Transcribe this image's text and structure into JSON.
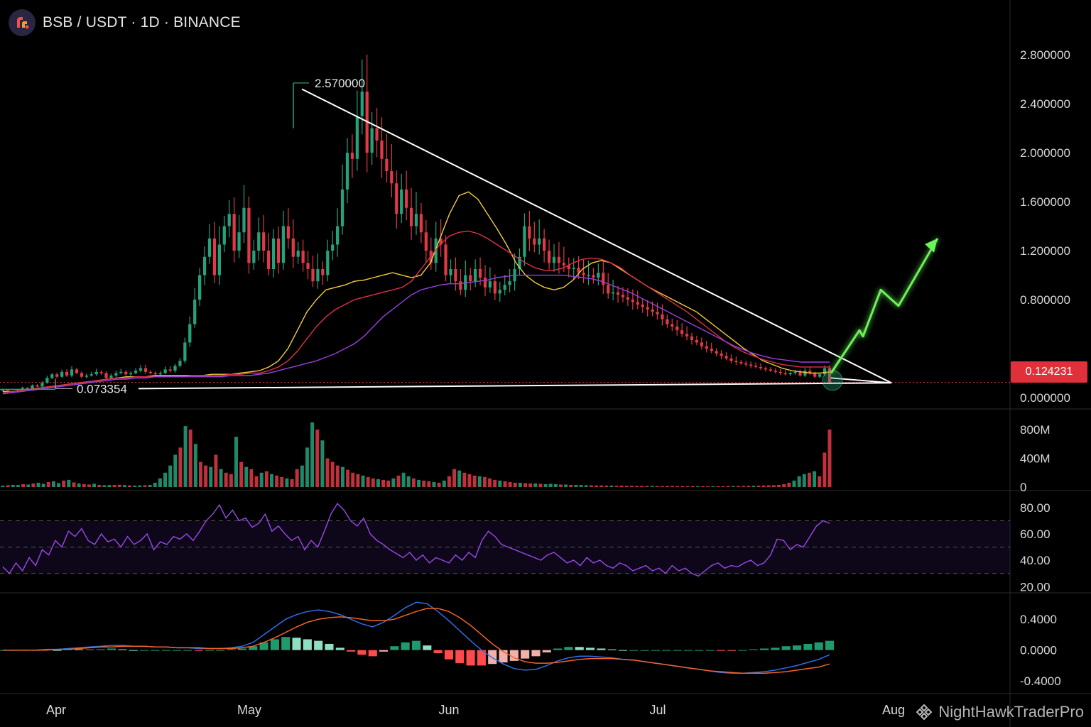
{
  "header": {
    "title": "BSB / USDT · 1D · BINANCE",
    "logo_icon": "exchange-logo-icon"
  },
  "watermark": {
    "text": "NightHawkTraderPro",
    "icon": "binance-diamond-icon"
  },
  "last_price": "0.124231",
  "colors": {
    "up": "#26a17b",
    "down": "#e03a45",
    "ema_fast": "#f2cc3a",
    "ema_mid": "#e0304a",
    "ema_slow": "#9a3fe0",
    "trendline": "#ffffff",
    "projection": "#6cf25a",
    "rsi_line": "#9b48e8",
    "macd_line": "#2f6fe8",
    "signal_line": "#f0642a",
    "price_badge": "#e0303a"
  },
  "chart_data": [
    {
      "type": "candlestick",
      "panel": "price",
      "title": "BSB / USDT · 1D · BINANCE",
      "x_tick_labels": [
        "Apr",
        "May",
        "Jun",
        "Jul",
        "Aug"
      ],
      "y_tick_labels": [
        "2.800000",
        "2.400000",
        "2.000000",
        "1.600000",
        "1.200000",
        "0.800000",
        "0.000000"
      ],
      "ylim": [
        0,
        2.9
      ],
      "annotations": [
        {
          "label": "2.570000",
          "type": "high"
        },
        {
          "label": "0.073354",
          "type": "low"
        }
      ],
      "current_price": 0.124231,
      "trendlines": [
        {
          "name": "upper",
          "from": [
            0.425,
            2.52
          ],
          "to": [
            1.255,
            0.12
          ]
        },
        {
          "name": "lower",
          "from": [
            0.195,
            0.073354
          ],
          "to": [
            1.255,
            0.12
          ]
        }
      ],
      "projection_path": [
        [
          1.17,
          0.2
        ],
        [
          1.21,
          0.55
        ],
        [
          1.215,
          0.5
        ],
        [
          1.24,
          0.88
        ],
        [
          1.265,
          0.75
        ],
        [
          1.32,
          1.3
        ]
      ],
      "closes": [
        0.06,
        0.05,
        0.05,
        0.06,
        0.08,
        0.07,
        0.1,
        0.09,
        0.12,
        0.16,
        0.19,
        0.17,
        0.21,
        0.18,
        0.23,
        0.2,
        0.17,
        0.18,
        0.19,
        0.21,
        0.2,
        0.16,
        0.18,
        0.2,
        0.21,
        0.19,
        0.2,
        0.22,
        0.24,
        0.21,
        0.2,
        0.19,
        0.2,
        0.23,
        0.22,
        0.26,
        0.3,
        0.45,
        0.6,
        0.8,
        1.0,
        1.15,
        1.3,
        1.0,
        1.25,
        1.4,
        1.5,
        1.2,
        1.35,
        1.55,
        1.1,
        1.2,
        1.35,
        1.2,
        1.05,
        1.3,
        1.1,
        1.4,
        1.3,
        1.15,
        1.2,
        1.1,
        1.05,
        0.95,
        1.05,
        1.0,
        1.2,
        1.25,
        1.4,
        1.7,
        2.0,
        1.95,
        2.3,
        2.5,
        2.0,
        2.2,
        2.1,
        1.95,
        1.85,
        1.75,
        1.5,
        1.7,
        1.55,
        1.4,
        1.5,
        1.35,
        1.2,
        1.1,
        1.3,
        1.25,
        1.0,
        1.05,
        0.95,
        0.88,
        1.0,
        0.95,
        1.05,
        0.98,
        0.9,
        0.95,
        0.85,
        0.88,
        0.92,
        0.95,
        1.05,
        1.15,
        1.4,
        1.3,
        1.25,
        1.3,
        1.2,
        1.1,
        1.15,
        1.1,
        1.08,
        1.05,
        1.06,
        1.02,
        1.0,
        1.0,
        0.98,
        1.02,
        0.92,
        0.85,
        0.86,
        0.84,
        0.82,
        0.8,
        0.78,
        0.76,
        0.74,
        0.72,
        0.7,
        0.68,
        0.64,
        0.6,
        0.58,
        0.55,
        0.52,
        0.5,
        0.47,
        0.45,
        0.42,
        0.4,
        0.38,
        0.36,
        0.34,
        0.32,
        0.3,
        0.29,
        0.28,
        0.27,
        0.26,
        0.25,
        0.24,
        0.23,
        0.22,
        0.21,
        0.2,
        0.19,
        0.2,
        0.21,
        0.18,
        0.22,
        0.2,
        0.17,
        0.19,
        0.24,
        0.124231
      ],
      "moving_averages": [
        {
          "name": "",
          "values": [
            0.05,
            0.05,
            0.06,
            0.07,
            0.08,
            0.09,
            0.1,
            0.11,
            0.12,
            0.13,
            0.14,
            0.15,
            0.16,
            0.17,
            0.17,
            0.17,
            0.18,
            0.18,
            0.18,
            0.18,
            0.18,
            0.18,
            0.19,
            0.19,
            0.19,
            0.2,
            0.21,
            0.22,
            0.25,
            0.3,
            0.4,
            0.55,
            0.7,
            0.8,
            0.88,
            0.9,
            0.92,
            0.95,
            0.96,
            0.98,
            1.0,
            1.02,
            1.0,
            0.98,
            1.0,
            1.1,
            1.3,
            1.5,
            1.65,
            1.68,
            1.62,
            1.5,
            1.38,
            1.25,
            1.1,
            1.0,
            0.94,
            0.9,
            0.88,
            0.9,
            0.96,
            1.05,
            1.1,
            1.12,
            1.1,
            1.05,
            1.0,
            0.95,
            0.9,
            0.86,
            0.82,
            0.78,
            0.74,
            0.7,
            0.64,
            0.58,
            0.52,
            0.46,
            0.4,
            0.35,
            0.3,
            0.27,
            0.24,
            0.22,
            0.21,
            0.2,
            0.2,
            0.21
          ]
        },
        {
          "name": "",
          "values": [
            0.04,
            0.05,
            0.06,
            0.07,
            0.08,
            0.09,
            0.1,
            0.11,
            0.12,
            0.13,
            0.14,
            0.15,
            0.16,
            0.16,
            0.17,
            0.17,
            0.17,
            0.17,
            0.17,
            0.17,
            0.18,
            0.18,
            0.18,
            0.18,
            0.19,
            0.19,
            0.2,
            0.2,
            0.22,
            0.25,
            0.3,
            0.38,
            0.48,
            0.58,
            0.66,
            0.72,
            0.76,
            0.8,
            0.82,
            0.84,
            0.86,
            0.88,
            0.9,
            0.95,
            1.05,
            1.15,
            1.25,
            1.32,
            1.35,
            1.36,
            1.34,
            1.3,
            1.25,
            1.2,
            1.15,
            1.1,
            1.06,
            1.04,
            1.04,
            1.06,
            1.1,
            1.13,
            1.14,
            1.13,
            1.1,
            1.06,
            1.0,
            0.95,
            0.9,
            0.85,
            0.8,
            0.75,
            0.7,
            0.64,
            0.58,
            0.52,
            0.46,
            0.41,
            0.37,
            0.34,
            0.31,
            0.29,
            0.27,
            0.26,
            0.25,
            0.25,
            0.25,
            0.25
          ]
        },
        {
          "name": "",
          "values": [
            0.03,
            0.04,
            0.05,
            0.06,
            0.07,
            0.08,
            0.09,
            0.1,
            0.11,
            0.12,
            0.13,
            0.14,
            0.15,
            0.15,
            0.16,
            0.16,
            0.17,
            0.17,
            0.17,
            0.17,
            0.17,
            0.17,
            0.17,
            0.17,
            0.18,
            0.18,
            0.18,
            0.19,
            0.2,
            0.22,
            0.24,
            0.26,
            0.28,
            0.3,
            0.33,
            0.36,
            0.4,
            0.44,
            0.5,
            0.58,
            0.66,
            0.72,
            0.78,
            0.84,
            0.88,
            0.9,
            0.92,
            0.93,
            0.93,
            0.94,
            0.95,
            0.96,
            0.98,
            0.99,
            1.0,
            1.0,
            1.0,
            1.0,
            1.0,
            1.0,
            0.99,
            0.98,
            0.97,
            0.95,
            0.92,
            0.89,
            0.86,
            0.82,
            0.78,
            0.74,
            0.7,
            0.66,
            0.62,
            0.58,
            0.54,
            0.5,
            0.46,
            0.42,
            0.39,
            0.36,
            0.34,
            0.32,
            0.31,
            0.3,
            0.29,
            0.29,
            0.29,
            0.29
          ]
        }
      ]
    },
    {
      "type": "bar",
      "panel": "volume",
      "y_tick_labels": [
        "800M",
        "400M",
        "0"
      ],
      "ylim": [
        0,
        900
      ],
      "values_millions": [
        20,
        25,
        30,
        28,
        40,
        35,
        50,
        60,
        45,
        70,
        80,
        55,
        90,
        100,
        65,
        50,
        40,
        35,
        45,
        30,
        25,
        28,
        30,
        32,
        28,
        24,
        20,
        22,
        25,
        30,
        60,
        120,
        200,
        300,
        450,
        550,
        850,
        800,
        600,
        350,
        300,
        280,
        450,
        250,
        200,
        180,
        700,
        350,
        280,
        250,
        150,
        200,
        220,
        180,
        160,
        140,
        120,
        110,
        250,
        300,
        550,
        900,
        800,
        650,
        400,
        350,
        300,
        280,
        240,
        200,
        180,
        160,
        140,
        120,
        110,
        100,
        90,
        120,
        160,
        200,
        150,
        120,
        100,
        90,
        80,
        70,
        60,
        90,
        150,
        250,
        230,
        200,
        180,
        160,
        150,
        140,
        120,
        100,
        90,
        80,
        70,
        60,
        60,
        55,
        50,
        50,
        45,
        40,
        45,
        40,
        35,
        35,
        30,
        30,
        28,
        25,
        25,
        22,
        22,
        20,
        20,
        18,
        20,
        18,
        18,
        16,
        16,
        15,
        15,
        14,
        14,
        15,
        16,
        14,
        14,
        13,
        13,
        12,
        12,
        12,
        12,
        12,
        13,
        14,
        14,
        15,
        16,
        17,
        18,
        20,
        22,
        24,
        26,
        30,
        40,
        60,
        90,
        150,
        180,
        200,
        220,
        150,
        480,
        800
      ],
      "up_flags": [
        1,
        0,
        1,
        1,
        0,
        1,
        0,
        1,
        1,
        0,
        1,
        1,
        0,
        1,
        0,
        1,
        0,
        0,
        1,
        0,
        1,
        1,
        0,
        0,
        1,
        0,
        1,
        1,
        0,
        1,
        1,
        1,
        1,
        1,
        1,
        0,
        1,
        0,
        1,
        0,
        0,
        1,
        0,
        1,
        0,
        0,
        1,
        0,
        1,
        0,
        0,
        1,
        0,
        1,
        0,
        0,
        1,
        0,
        0,
        1,
        1,
        1,
        0,
        1,
        0,
        0,
        0,
        1,
        0,
        0,
        0,
        1,
        0,
        0,
        1,
        0,
        0,
        1,
        0,
        1,
        1,
        0,
        1,
        0,
        0,
        1,
        0,
        1,
        0,
        0,
        1,
        0,
        0,
        0,
        1,
        0,
        0,
        0,
        1,
        0,
        0,
        0,
        1,
        0,
        0,
        1,
        0,
        1,
        1,
        1,
        0,
        1,
        0,
        1,
        1,
        1,
        0,
        0,
        0,
        0,
        1,
        0,
        0,
        0,
        0,
        0,
        0,
        0,
        1,
        0,
        0,
        0,
        0,
        0,
        0,
        0,
        0,
        1,
        0,
        0,
        1,
        0,
        0,
        0,
        1,
        0,
        0,
        0,
        1,
        0,
        0,
        0,
        0,
        0,
        0,
        0,
        1,
        1,
        1,
        0,
        1,
        0,
        0,
        0,
        1,
        1,
        1
      ]
    },
    {
      "type": "line",
      "panel": "rsi",
      "y_tick_labels": [
        "80.00",
        "60.00",
        "40.00",
        "20.00"
      ],
      "ylim": [
        18,
        88
      ],
      "band": [
        30,
        70
      ],
      "midline": 50,
      "values": [
        35,
        30,
        38,
        32,
        42,
        36,
        48,
        44,
        55,
        50,
        62,
        58,
        64,
        55,
        52,
        60,
        54,
        56,
        50,
        58,
        52,
        55,
        60,
        48,
        54,
        52,
        58,
        56,
        60,
        55,
        62,
        70,
        75,
        82,
        72,
        78,
        70,
        72,
        65,
        68,
        75,
        62,
        66,
        60,
        55,
        58,
        48,
        55,
        50,
        62,
        75,
        83,
        78,
        70,
        66,
        72,
        60,
        55,
        52,
        48,
        45,
        42,
        46,
        40,
        44,
        38,
        42,
        40,
        38,
        44,
        40,
        46,
        42,
        55,
        62,
        58,
        52,
        50,
        48,
        46,
        44,
        42,
        40,
        44,
        46,
        42,
        38,
        40,
        36,
        42,
        38,
        40,
        36,
        34,
        38,
        36,
        32,
        34,
        36,
        32,
        34,
        30,
        36,
        32,
        34,
        30,
        28,
        32,
        36,
        38,
        34,
        36,
        35,
        38,
        40,
        36,
        38,
        44,
        56,
        55,
        48,
        52,
        50,
        58,
        66,
        70,
        68
      ]
    },
    {
      "type": "line",
      "panel": "macd",
      "y_tick_labels": [
        "0.4000",
        "0.0000",
        "-0.4000"
      ],
      "ylim": [
        -0.5,
        0.65
      ],
      "macd": [
        0.0,
        0.0,
        0.0,
        0.0,
        0.01,
        0.01,
        0.02,
        0.03,
        0.04,
        0.05,
        0.06,
        0.06,
        0.05,
        0.05,
        0.04,
        0.04,
        0.03,
        0.03,
        0.02,
        0.02,
        0.02,
        0.03,
        0.05,
        0.1,
        0.2,
        0.3,
        0.4,
        0.46,
        0.5,
        0.52,
        0.5,
        0.46,
        0.4,
        0.34,
        0.3,
        0.36,
        0.45,
        0.55,
        0.62,
        0.6,
        0.5,
        0.38,
        0.25,
        0.12,
        0.0,
        -0.1,
        -0.18,
        -0.24,
        -0.26,
        -0.25,
        -0.2,
        -0.14,
        -0.1,
        -0.08,
        -0.08,
        -0.09,
        -0.1,
        -0.12,
        -0.13,
        -0.15,
        -0.17,
        -0.19,
        -0.21,
        -0.23,
        -0.25,
        -0.27,
        -0.29,
        -0.3,
        -0.3,
        -0.29,
        -0.28,
        -0.26,
        -0.23,
        -0.2,
        -0.16,
        -0.12,
        -0.06
      ],
      "signal": [
        0.0,
        0.0,
        0.0,
        0.0,
        0.0,
        0.01,
        0.01,
        0.02,
        0.03,
        0.04,
        0.04,
        0.05,
        0.05,
        0.05,
        0.04,
        0.04,
        0.03,
        0.03,
        0.03,
        0.02,
        0.02,
        0.02,
        0.03,
        0.05,
        0.1,
        0.16,
        0.23,
        0.3,
        0.36,
        0.4,
        0.42,
        0.43,
        0.42,
        0.4,
        0.38,
        0.38,
        0.4,
        0.45,
        0.5,
        0.54,
        0.54,
        0.5,
        0.42,
        0.32,
        0.2,
        0.08,
        -0.02,
        -0.1,
        -0.15,
        -0.17,
        -0.17,
        -0.16,
        -0.14,
        -0.12,
        -0.11,
        -0.11,
        -0.11,
        -0.12,
        -0.13,
        -0.15,
        -0.17,
        -0.19,
        -0.21,
        -0.23,
        -0.25,
        -0.27,
        -0.28,
        -0.29,
        -0.3,
        -0.3,
        -0.3,
        -0.29,
        -0.28,
        -0.26,
        -0.24,
        -0.22,
        -0.18
      ]
    }
  ]
}
